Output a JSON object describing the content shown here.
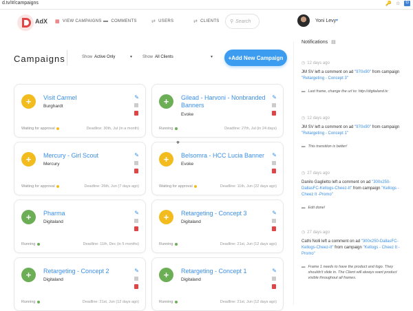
{
  "browser": {
    "url": "d.tv/#/campaigns"
  },
  "header": {
    "brand": "AdX",
    "nav": [
      {
        "label": "VIEW CAMPAIGNS",
        "icon": "grid-icon"
      },
      {
        "label": "COMMENTS",
        "icon": "comment-icon"
      },
      {
        "label": "USERS",
        "icon": "users-icon"
      },
      {
        "label": "CLIENTS",
        "icon": "clients-icon"
      }
    ],
    "search_placeholder": "Search",
    "user_name": "Yoni Levy"
  },
  "page": {
    "title": "Campaigns",
    "filter_status_label": "Show",
    "filter_status_value": "Active Only",
    "filter_client_label": "Show",
    "filter_client_value": "All Clients",
    "add_button": "+Add New Campaign"
  },
  "cards": [
    {
      "title": "Visit Carmel",
      "client": "Burghardt",
      "status": "Waiting for approval",
      "deadline": "Deadline: 30th, Jul (in a month)",
      "color": "#f2bb1e"
    },
    {
      "title": "Gilead - Harvoni - Nonbranded Banners",
      "client": "Evoke",
      "status": "Running",
      "deadline": "Deadline: 27th, Jul (in 24 days)",
      "color": "#6cae55"
    },
    {
      "title": "Mercury - Girl Scout",
      "client": "Mercury",
      "status": "Waiting for approval",
      "deadline": "Deadline: 26th, Jun (7 days ago)",
      "color": "#f2bb1e"
    },
    {
      "title": "Belsomra - HCC Lucia Banner",
      "client": "Evoke",
      "status": "Waiting for approval",
      "deadline": "Deadline: 11th, Jun (22 days ago)",
      "color": "#f2bb1e"
    },
    {
      "title": "Pharma",
      "client": "Digitaland",
      "status": "Running",
      "deadline": "Deadline: 11th, Dec (in 5 months)",
      "color": "#6cae55"
    },
    {
      "title": "Retargeting - Concept 3",
      "client": "Digitaland",
      "status": "Running",
      "deadline": "Deadline: 21st, Jun (12 days ago)",
      "color": "#f2bb1e"
    },
    {
      "title": "Retargeting - Concept 2",
      "client": "Digitaland",
      "status": "Running",
      "deadline": "Deadline: 21st, Jun (12 days ago)",
      "color": "#6cae55"
    },
    {
      "title": "Retargeting - Concept 1",
      "client": "Digitaland",
      "status": "Running",
      "deadline": "Deadline: 21st, Jun (12 days ago)",
      "color": "#6cae55"
    }
  ],
  "notifications": {
    "title": "Notifications",
    "items": [
      {
        "time": "12 days ago",
        "author": "JM SV",
        "ad": "\"970x90\"",
        "campaign": "\"Retargeting - Concept 3\"",
        "comment": "Last frame, change the url to: http://digitaland.tv"
      },
      {
        "time": "12 days ago",
        "author": "JM SV",
        "ad": "\"970x90\"",
        "campaign": "\"Retargeting - Concept 1\"",
        "comment": "This transition is better!"
      },
      {
        "time": "27 days ago",
        "author": "Danilo Gaglietto",
        "ad": "\"300x250-DallasFC-Kellogs-Cheez-It\"",
        "campaign": "\"Kellogs - Cheez It -Promo\"",
        "comment": "Edit done!"
      },
      {
        "time": "27 days ago",
        "author": "Cathi Nolli",
        "ad": "\"300x250-DallasFC-Kellogs-Cheez-It\"",
        "campaign": "\"Kellogs - Cheez It -Promo\"",
        "comment": "Frame 1 needs to have the product and logo. They shouldn't slide in. The Client will always want product visible throughout all frames."
      }
    ],
    "left_text": "left a comment on ad",
    "from_text": "from campaign"
  }
}
